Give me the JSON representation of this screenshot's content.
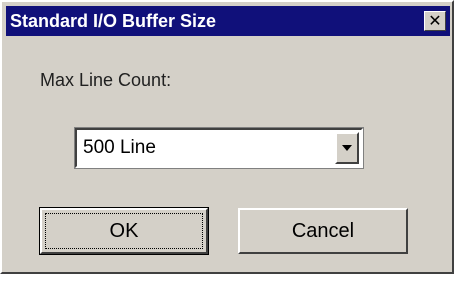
{
  "window": {
    "title": "Standard I/O Buffer Size",
    "close_icon": "close-icon"
  },
  "form": {
    "max_line_label": "Max Line Count:",
    "max_line_value": "500 Line",
    "dropdown_icon": "chevron-down-icon"
  },
  "buttons": {
    "ok_label": "OK",
    "cancel_label": "Cancel"
  },
  "colors": {
    "titlebar": "#10107a",
    "dialog_face": "#d4d0c8"
  }
}
